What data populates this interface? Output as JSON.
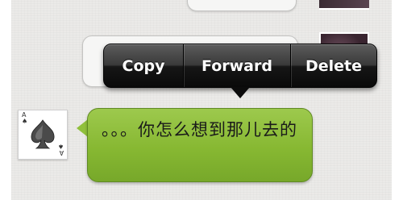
{
  "context_menu": {
    "items": [
      {
        "label": "Copy"
      },
      {
        "label": "Forward"
      },
      {
        "label": "Delete"
      }
    ]
  },
  "contact_avatar": {
    "icon": "spade-card-icon",
    "corner_rank": "A",
    "corner_suit": "♠"
  },
  "message": {
    "text": "。。。你怎么想到那儿去的",
    "bubble_color": "#8cbc38",
    "direction": "incoming"
  }
}
